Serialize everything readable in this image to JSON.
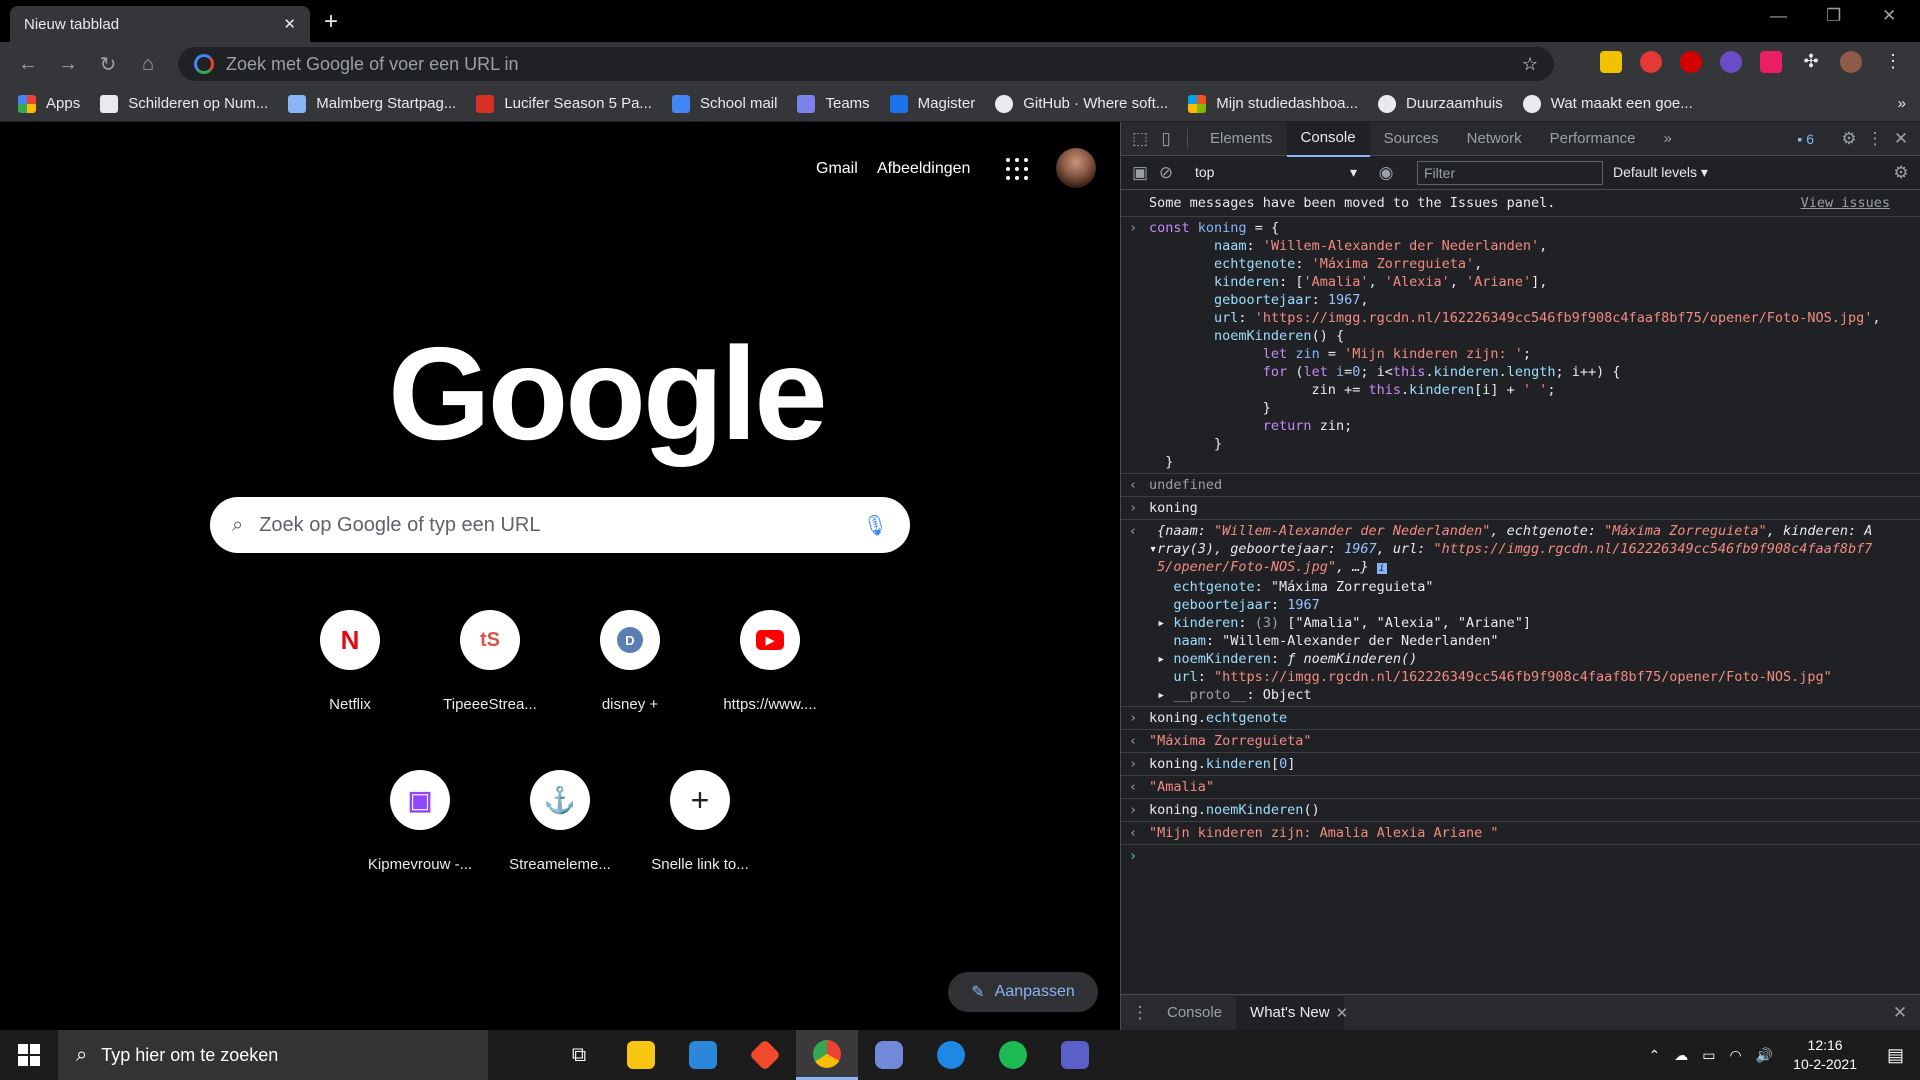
{
  "browser": {
    "tab_title": "Nieuw tabblad",
    "omnibox_placeholder": "Zoek met Google of voer een URL in",
    "bookmarks": [
      {
        "label": "Apps",
        "color": "#ea4335"
      },
      {
        "label": "Schilderen op Num...",
        "color": "#e8eaed"
      },
      {
        "label": "Malmberg Startpag...",
        "color": "#8ab4f8"
      },
      {
        "label": "Lucifer Season 5 Pa...",
        "color": "#d93025"
      },
      {
        "label": "School mail",
        "color": "#4285f4"
      },
      {
        "label": "Teams",
        "color": "#7b83eb"
      },
      {
        "label": "Magister",
        "color": "#1a73e8"
      },
      {
        "label": "GitHub · Where soft...",
        "color": "#e8eaed"
      },
      {
        "label": "Mijn studiedashboa...",
        "color": "#f9ab00"
      },
      {
        "label": "Duurzaamhuis",
        "color": "#e8eaed"
      },
      {
        "label": "Wat maakt een goe...",
        "color": "#e8eaed"
      }
    ]
  },
  "newtab": {
    "links": {
      "gmail": "Gmail",
      "images": "Afbeeldingen"
    },
    "logo": "Google",
    "search_placeholder": "Zoek op Google of typ een URL",
    "shortcuts": [
      {
        "label": "Netflix",
        "glyph": "N",
        "color": "#e50914"
      },
      {
        "label": "TipeeeStrea...",
        "glyph": "tS",
        "color": "#d9534f"
      },
      {
        "label": "disney +",
        "glyph": "D",
        "color": "#5b7fb4"
      },
      {
        "label": "https://www....",
        "glyph": "▶",
        "color": "#ff0000"
      },
      {
        "label": "Kipmevrouw -...",
        "glyph": "▣",
        "color": "#9146ff"
      },
      {
        "label": "Streameleme...",
        "glyph": "⚓",
        "color": "#e86b5f"
      },
      {
        "label": "Snelle link to...",
        "glyph": "+",
        "color": "#202124"
      }
    ],
    "customize": "Aanpassen"
  },
  "devtools": {
    "tabs": [
      "Elements",
      "Console",
      "Sources",
      "Network",
      "Performance"
    ],
    "more": "»",
    "issues_count": "6",
    "context": "top",
    "filter_placeholder": "Filter",
    "levels": "Default levels ▾",
    "info": "Some messages have been moved to the Issues panel.",
    "view_issues": "View issues",
    "drawer_tabs": [
      "Console",
      "What's New"
    ]
  },
  "taskbar": {
    "search": "Typ hier om te zoeken",
    "time": "12:16",
    "date": "10-2-2021"
  }
}
